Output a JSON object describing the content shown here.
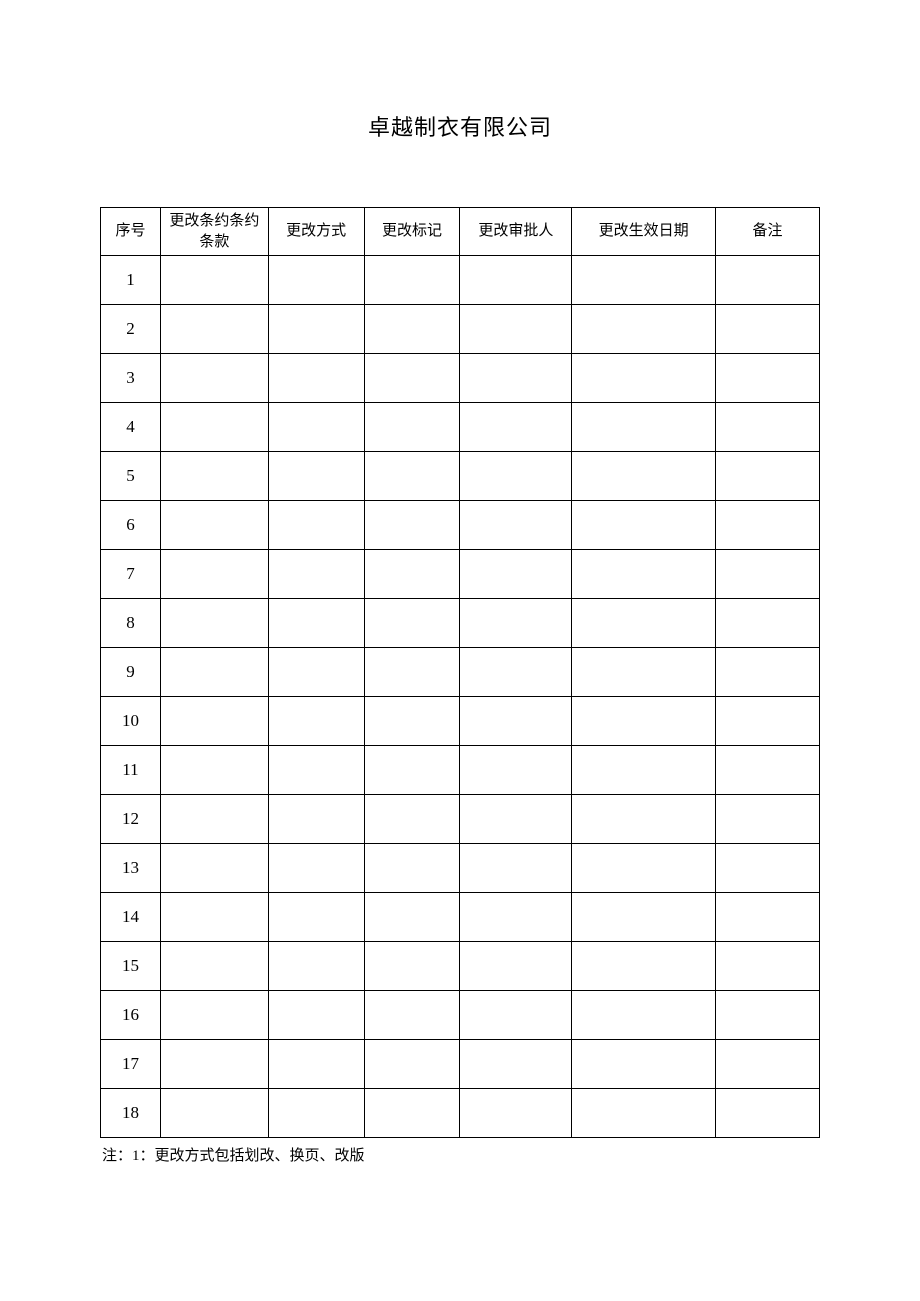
{
  "title": "卓越制衣有限公司",
  "headers": {
    "seq": "序号",
    "clause": "更改条约条约条款",
    "method": "更改方式",
    "mark": "更改标记",
    "approver": "更改审批人",
    "date": "更改生效日期",
    "remark": "备注"
  },
  "rows": [
    {
      "seq": "1",
      "clause": "",
      "method": "",
      "mark": "",
      "approver": "",
      "date": "",
      "remark": ""
    },
    {
      "seq": "2",
      "clause": "",
      "method": "",
      "mark": "",
      "approver": "",
      "date": "",
      "remark": ""
    },
    {
      "seq": "3",
      "clause": "",
      "method": "",
      "mark": "",
      "approver": "",
      "date": "",
      "remark": ""
    },
    {
      "seq": "4",
      "clause": "",
      "method": "",
      "mark": "",
      "approver": "",
      "date": "",
      "remark": ""
    },
    {
      "seq": "5",
      "clause": "",
      "method": "",
      "mark": "",
      "approver": "",
      "date": "",
      "remark": ""
    },
    {
      "seq": "6",
      "clause": "",
      "method": "",
      "mark": "",
      "approver": "",
      "date": "",
      "remark": ""
    },
    {
      "seq": "7",
      "clause": "",
      "method": "",
      "mark": "",
      "approver": "",
      "date": "",
      "remark": ""
    },
    {
      "seq": "8",
      "clause": "",
      "method": "",
      "mark": "",
      "approver": "",
      "date": "",
      "remark": ""
    },
    {
      "seq": "9",
      "clause": "",
      "method": "",
      "mark": "",
      "approver": "",
      "date": "",
      "remark": ""
    },
    {
      "seq": "10",
      "clause": "",
      "method": "",
      "mark": "",
      "approver": "",
      "date": "",
      "remark": ""
    },
    {
      "seq": "11",
      "clause": "",
      "method": "",
      "mark": "",
      "approver": "",
      "date": "",
      "remark": ""
    },
    {
      "seq": "12",
      "clause": "",
      "method": "",
      "mark": "",
      "approver": "",
      "date": "",
      "remark": ""
    },
    {
      "seq": "13",
      "clause": "",
      "method": "",
      "mark": "",
      "approver": "",
      "date": "",
      "remark": ""
    },
    {
      "seq": "14",
      "clause": "",
      "method": "",
      "mark": "",
      "approver": "",
      "date": "",
      "remark": ""
    },
    {
      "seq": "15",
      "clause": "",
      "method": "",
      "mark": "",
      "approver": "",
      "date": "",
      "remark": ""
    },
    {
      "seq": "16",
      "clause": "",
      "method": "",
      "mark": "",
      "approver": "",
      "date": "",
      "remark": ""
    },
    {
      "seq": "17",
      "clause": "",
      "method": "",
      "mark": "",
      "approver": "",
      "date": "",
      "remark": ""
    },
    {
      "seq": "18",
      "clause": "",
      "method": "",
      "mark": "",
      "approver": "",
      "date": "",
      "remark": ""
    }
  ],
  "footnote": "注：1：更改方式包括划改、换页、改版"
}
